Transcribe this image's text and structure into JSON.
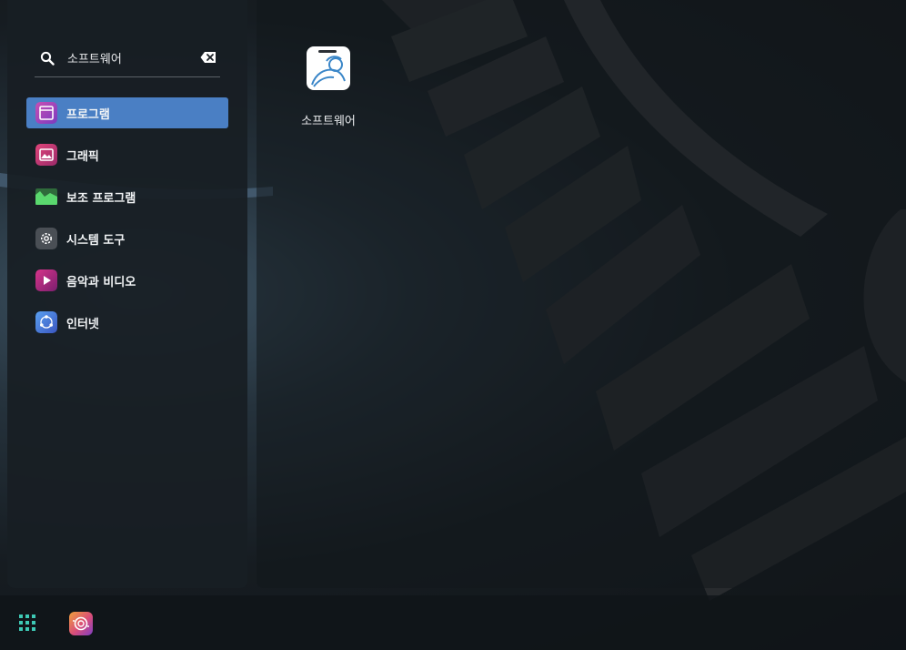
{
  "search": {
    "value": "소프트웨어",
    "icon": "search-icon",
    "clear_icon": "backspace-icon"
  },
  "categories": [
    {
      "label": "프로그램",
      "icon": "window-icon",
      "active": true
    },
    {
      "label": "그래픽",
      "icon": "image-icon",
      "active": false
    },
    {
      "label": "보조 프로그램",
      "icon": "accessories-icon",
      "active": false
    },
    {
      "label": "시스템 도구",
      "icon": "gear-icon",
      "active": false
    },
    {
      "label": "음악과 비디오",
      "icon": "play-icon",
      "active": false
    },
    {
      "label": "인터넷",
      "icon": "network-icon",
      "active": false
    }
  ],
  "results": [
    {
      "label": "소프트웨어",
      "icon": "software-store-icon"
    }
  ],
  "taskbar": {
    "launcher_icon": "app-grid-icon",
    "pinned_app_icon": "camera-app-icon"
  },
  "colors": {
    "accent": "#4a7fc4",
    "launcher": "#3ec9b5"
  }
}
